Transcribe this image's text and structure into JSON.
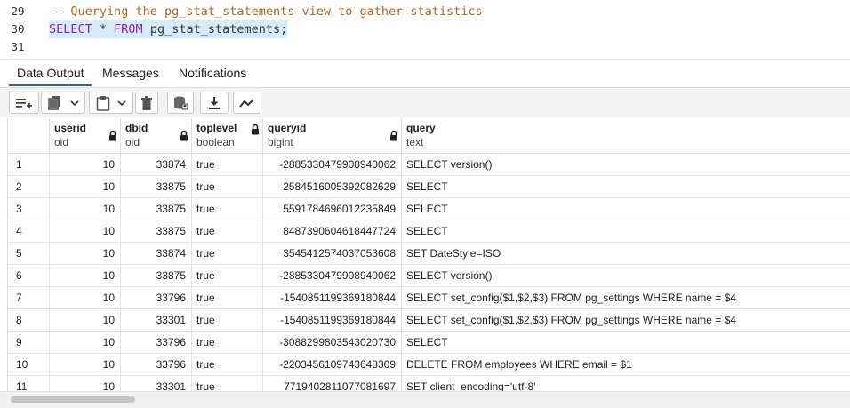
{
  "editor": {
    "lines": [
      {
        "number": "29",
        "code": "-- Querying the pg_stat_statements view to gather statistics"
      },
      {
        "number": "30",
        "kw1": "SELECT",
        "mid": " * ",
        "kw2": "FROM",
        "rest": " pg_stat_statements;"
      },
      {
        "number": "31",
        "code": ""
      }
    ]
  },
  "tabs": {
    "data_output": "Data Output",
    "messages": "Messages",
    "notifications": "Notifications",
    "active": "Data Output"
  },
  "toolbar": {
    "icons": [
      "add-row-icon",
      "copy-icon",
      "chevron-down-icon",
      "paste-icon",
      "chevron-down-icon",
      "delete-icon",
      "save-data-icon",
      "download-icon",
      "graph-visualiser-icon"
    ]
  },
  "grid": {
    "columns": [
      {
        "name": "userid",
        "type": "oid"
      },
      {
        "name": "dbid",
        "type": "oid"
      },
      {
        "name": "toplevel",
        "type": "boolean"
      },
      {
        "name": "queryid",
        "type": "bigint"
      },
      {
        "name": "query",
        "type": "text"
      }
    ],
    "rows": [
      {
        "n": "1",
        "userid": "10",
        "dbid": "33874",
        "toplevel": "true",
        "queryid": "-2885330479908940062",
        "query": "SELECT version()"
      },
      {
        "n": "2",
        "userid": "10",
        "dbid": "33875",
        "toplevel": "true",
        "queryid": "2584516005392082629",
        "query": "SELECT"
      },
      {
        "n": "3",
        "userid": "10",
        "dbid": "33875",
        "toplevel": "true",
        "queryid": "5591784696012235849",
        "query": "SELECT"
      },
      {
        "n": "4",
        "userid": "10",
        "dbid": "33875",
        "toplevel": "true",
        "queryid": "8487390604618447724",
        "query": "SELECT"
      },
      {
        "n": "5",
        "userid": "10",
        "dbid": "33874",
        "toplevel": "true",
        "queryid": "3545412574037053608",
        "query": "SET DateStyle=ISO"
      },
      {
        "n": "6",
        "userid": "10",
        "dbid": "33875",
        "toplevel": "true",
        "queryid": "-2885330479908940062",
        "query": "SELECT version()"
      },
      {
        "n": "7",
        "userid": "10",
        "dbid": "33796",
        "toplevel": "true",
        "queryid": "-1540851199369180844",
        "query": "SELECT set_config($1,$2,$3) FROM pg_settings WHERE name = $4"
      },
      {
        "n": "8",
        "userid": "10",
        "dbid": "33301",
        "toplevel": "true",
        "queryid": "-1540851199369180844",
        "query": "SELECT set_config($1,$2,$3) FROM pg_settings WHERE name = $4"
      },
      {
        "n": "9",
        "userid": "10",
        "dbid": "33796",
        "toplevel": "true",
        "queryid": "-3088299803543020730",
        "query": "SELECT"
      },
      {
        "n": "10",
        "userid": "10",
        "dbid": "33796",
        "toplevel": "true",
        "queryid": "-2203456109743648309",
        "query": "DELETE FROM employees WHERE email = $1"
      },
      {
        "n": "11",
        "userid": "10",
        "dbid": "33301",
        "toplevel": "true",
        "queryid": "7719402811077081697",
        "query": "SET client_encoding='utf-8'"
      }
    ]
  }
}
